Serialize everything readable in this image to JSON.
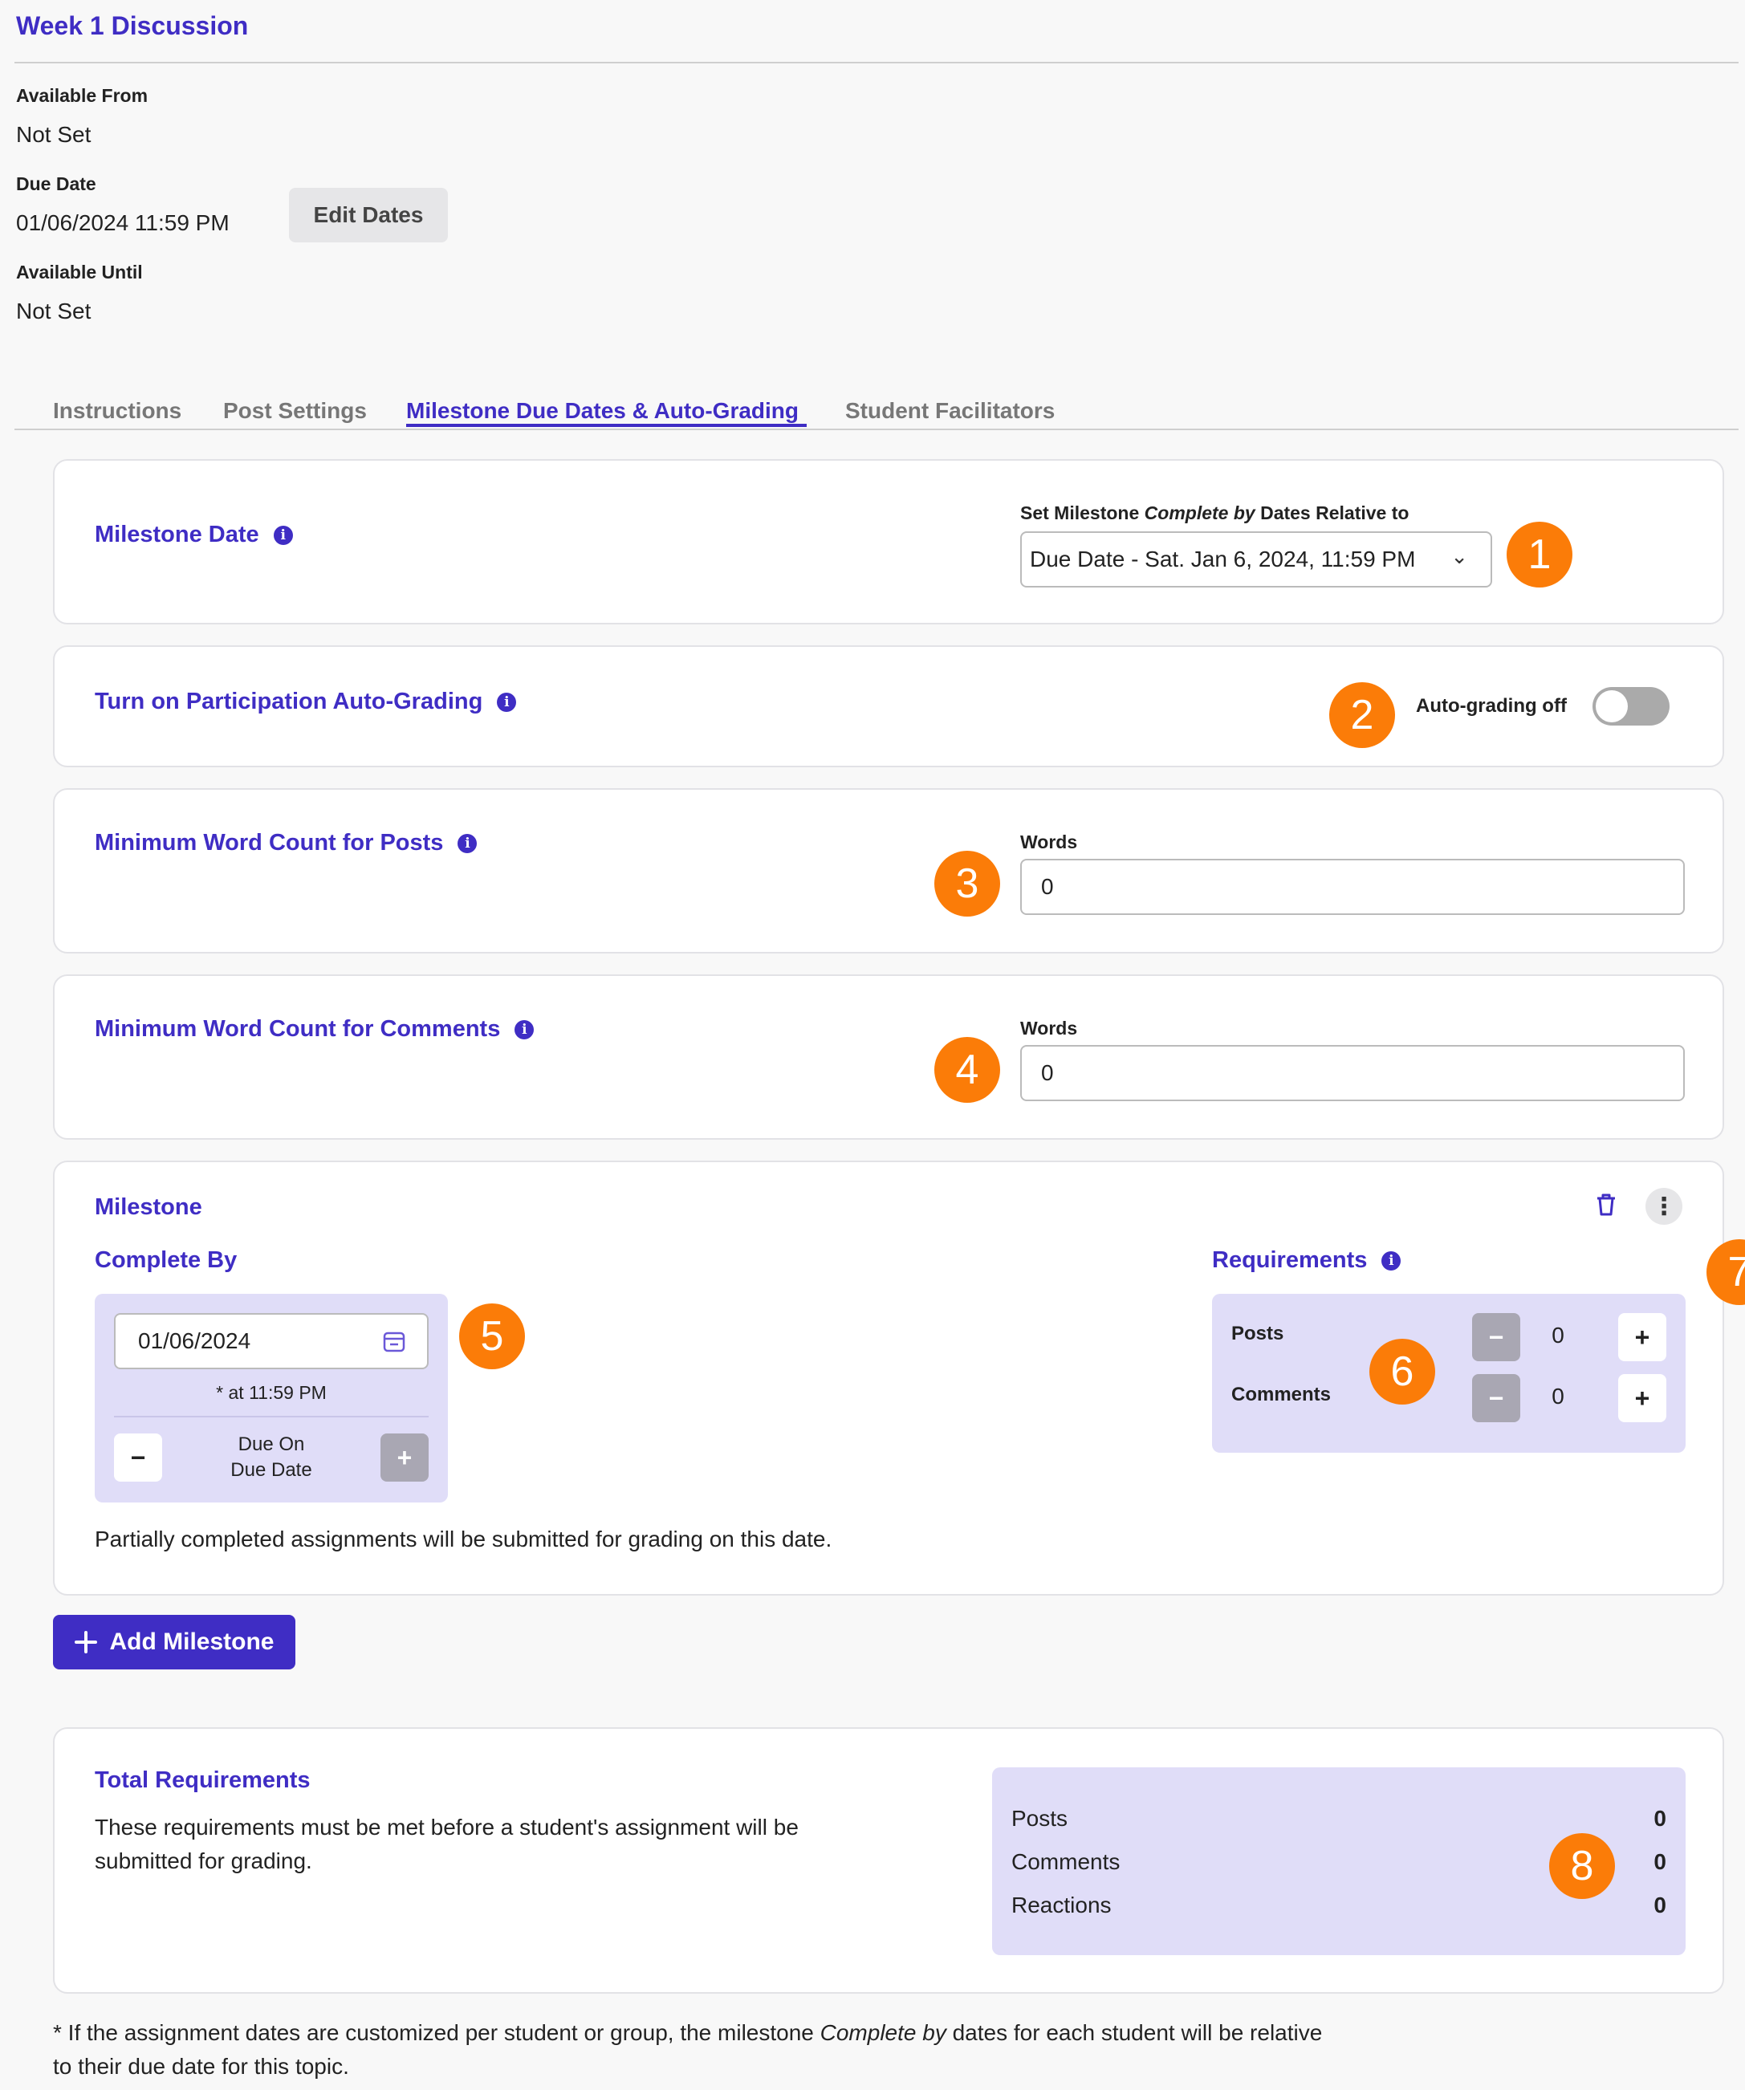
{
  "page": {
    "title": "Week 1 Discussion"
  },
  "dates": {
    "available_from_label": "Available From",
    "available_from_value": "Not Set",
    "due_date_label": "Due Date",
    "due_date_value": "01/06/2024 11:59 PM",
    "available_until_label": "Available Until",
    "available_until_value": "Not Set",
    "edit_button": "Edit Dates"
  },
  "tabs": [
    {
      "label": "Instructions"
    },
    {
      "label": "Post Settings"
    },
    {
      "label": "Milestone Due Dates & Auto-Grading",
      "active": true
    },
    {
      "label": "Student Facilitators"
    }
  ],
  "milestone_date": {
    "title": "Milestone Date",
    "select_label_pre": "Set Milestone ",
    "select_label_em": "Complete by",
    "select_label_post": " Dates Relative to",
    "select_value": "Due Date - Sat. Jan 6, 2024, 11:59 PM"
  },
  "auto_grading": {
    "title": "Turn on Participation Auto-Grading",
    "toggle_label": "Auto-grading off",
    "enabled": false
  },
  "min_posts": {
    "title": "Minimum Word Count for Posts",
    "field_label": "Words",
    "value": "0"
  },
  "min_comments": {
    "title": "Minimum Word Count for Comments",
    "field_label": "Words",
    "value": "0"
  },
  "milestone": {
    "title": "Milestone",
    "complete_by_label": "Complete By",
    "date_value": "01/06/2024",
    "time_note": "*  at 11:59 PM",
    "due_on_line1": "Due On",
    "due_on_line2": "Due Date",
    "minus": "−",
    "plus": "+",
    "requirements_label": "Requirements",
    "posts_label": "Posts",
    "posts_value": "0",
    "comments_label": "Comments",
    "comments_value": "0",
    "note": "Partially completed assignments will be submitted for grading on this date."
  },
  "add_milestone": "Add Milestone",
  "totals": {
    "title": "Total Requirements",
    "desc_line1": "These requirements must be met before a student's assignment will be",
    "desc_line2": "submitted for grading.",
    "posts_label": "Posts",
    "posts_value": "0",
    "comments_label": "Comments",
    "comments_value": "0",
    "reactions_label": "Reactions",
    "reactions_value": "0"
  },
  "footnote": {
    "pre": "* If the assignment dates are customized per student or group, the milestone ",
    "em": "Complete by",
    "post": " dates for each student will be relative",
    "line2": "to their due date for this topic."
  },
  "badges": [
    "1",
    "2",
    "3",
    "4",
    "5",
    "6",
    "7",
    "8"
  ],
  "colors": {
    "accent": "#3f2dc4",
    "badge": "#fb7c08",
    "panel": "#e0ddf8"
  }
}
